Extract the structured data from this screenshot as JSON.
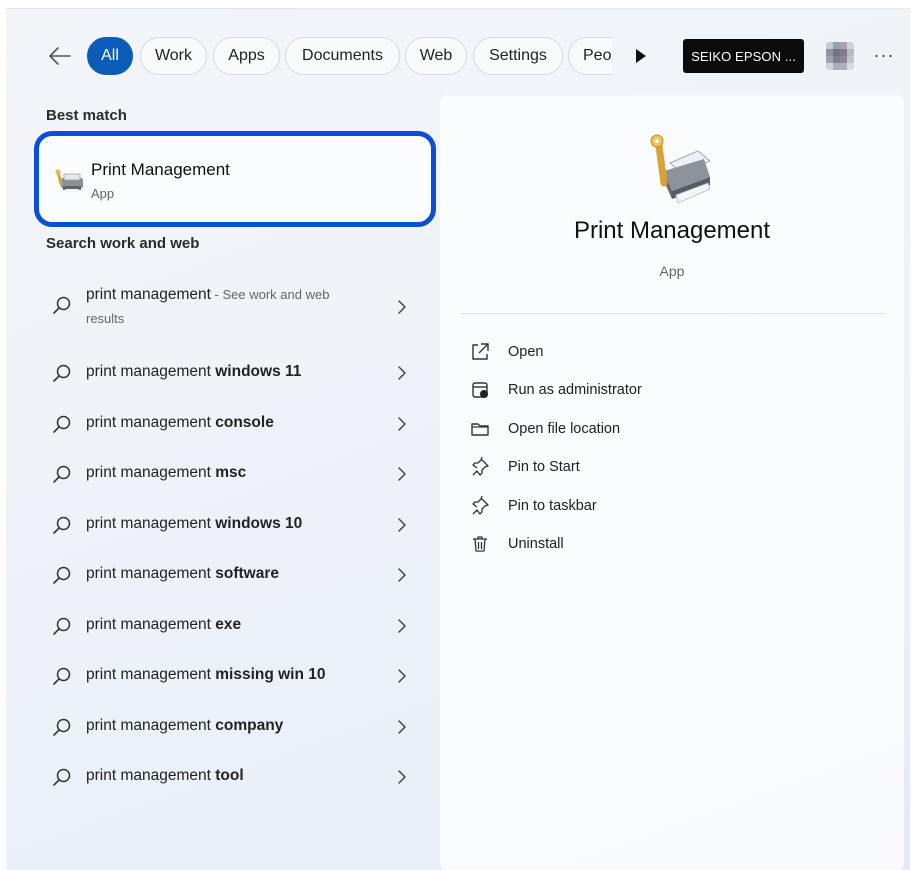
{
  "filter_bar": {
    "back_label": "Back",
    "tabs": [
      {
        "label": "All",
        "active": true
      },
      {
        "label": "Work"
      },
      {
        "label": "Apps"
      },
      {
        "label": "Documents"
      },
      {
        "label": "Web"
      },
      {
        "label": "Settings"
      },
      {
        "label": "Peo"
      }
    ],
    "account_label": "SEIKO EPSON ...",
    "more_label": "···"
  },
  "left_panel": {
    "best_match_heading": "Best match",
    "best_match": {
      "title": "Print Management",
      "subtitle": "App",
      "icon": "print-management-icon"
    },
    "search_heading": "Search work and web",
    "results": [
      {
        "prefix": "print management",
        "bold": "",
        "hint": " - See work and web results"
      },
      {
        "prefix": "print management ",
        "bold": "windows 11"
      },
      {
        "prefix": "print management ",
        "bold": "console"
      },
      {
        "prefix": "print management ",
        "bold": "msc"
      },
      {
        "prefix": "print management ",
        "bold": "windows 10"
      },
      {
        "prefix": "print management ",
        "bold": "software"
      },
      {
        "prefix": "print management ",
        "bold": "exe"
      },
      {
        "prefix": "print management ",
        "bold": "missing win 10"
      },
      {
        "prefix": "print management ",
        "bold": "company"
      },
      {
        "prefix": "print management ",
        "bold": "tool"
      }
    ]
  },
  "preview": {
    "title": "Print Management",
    "subtitle": "App",
    "actions": [
      {
        "label": "Open",
        "icon": "open-external-icon"
      },
      {
        "label": "Run as administrator",
        "icon": "shield-admin-icon"
      },
      {
        "label": "Open file location",
        "icon": "folder-icon"
      },
      {
        "label": "Pin to Start",
        "icon": "pin-icon"
      },
      {
        "label": "Pin to taskbar",
        "icon": "pin-icon"
      },
      {
        "label": "Uninstall",
        "icon": "trash-icon"
      }
    ]
  },
  "colors": {
    "accent": "#0a5cb8",
    "highlight_border": "#0a4fd6",
    "account_chip": "#0b0b0b"
  }
}
